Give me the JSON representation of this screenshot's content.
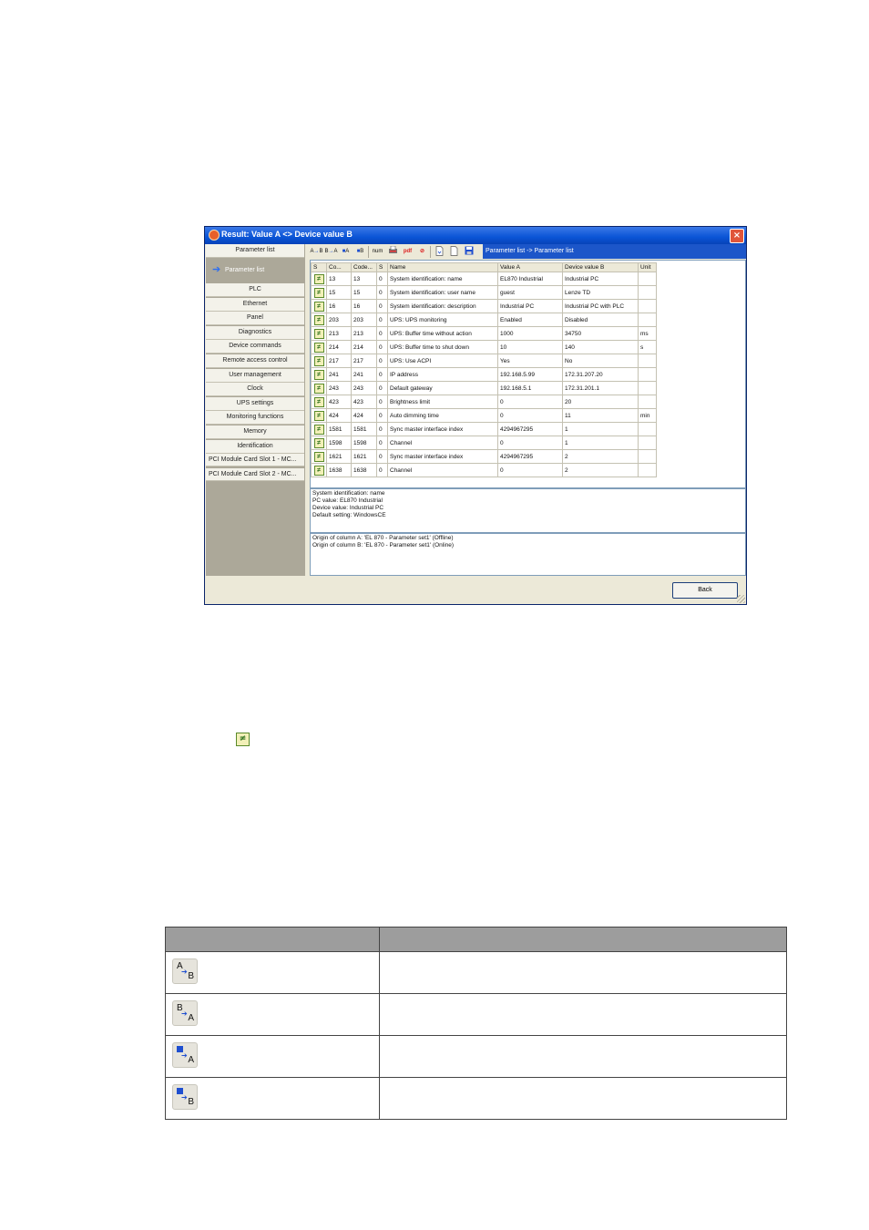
{
  "window": {
    "title": "Result: Value A <> Device value B",
    "close_label": "×",
    "breadcrumb": "Parameter list -> Parameter list",
    "back_label": "Back"
  },
  "nav": {
    "header": "Parameter list",
    "active": "Parameter list",
    "items": [
      "PLC",
      "Ethernet",
      "Panel",
      "Diagnostics",
      "Device commands",
      "Remote access control",
      "User management",
      "Clock",
      "UPS settings",
      "Monitoring functions",
      "Memory",
      "Identification",
      "PCI Module Card Slot 1 - MC...",
      "PCI Module Card Slot 2 - MC..."
    ]
  },
  "toolbar": {
    "ab": "A→B",
    "ba": "B→A",
    "copy_a": "■A",
    "copy_b": "■B",
    "num": "num",
    "print": "print-icon",
    "pdf": "pdf-icon",
    "filter": "filter-icon",
    "doc1": "doc-icon",
    "doc2": "doc-icon",
    "save": "save-icon"
  },
  "grid": {
    "columns": [
      "S",
      "Co...",
      "Code...",
      "S",
      "Name",
      "Value A",
      "Device value B",
      "Unit"
    ],
    "rows": [
      [
        "13",
        "13",
        "0",
        "System identification: name",
        "EL870 Industrial",
        "Industrial PC",
        ""
      ],
      [
        "15",
        "15",
        "0",
        "System identification: user name",
        "guest",
        "Lenze TD",
        ""
      ],
      [
        "16",
        "16",
        "0",
        "System identification: description",
        "Industrial PC",
        "Industrial PC with PLC",
        ""
      ],
      [
        "203",
        "203",
        "0",
        "UPS: UPS monitoring",
        "Enabled",
        "Disabled",
        ""
      ],
      [
        "213",
        "213",
        "0",
        "UPS: Buffer time without action",
        "1000",
        "34750",
        "ms"
      ],
      [
        "214",
        "214",
        "0",
        "UPS: Buffer time to shut down",
        "10",
        "140",
        "s"
      ],
      [
        "217",
        "217",
        "0",
        "UPS: Use ACPI",
        "Yes",
        "No",
        ""
      ],
      [
        "241",
        "241",
        "0",
        "IP address",
        "192.168.5.99",
        "172.31.207.20",
        ""
      ],
      [
        "243",
        "243",
        "0",
        "Default gateway",
        "192.168.5.1",
        "172.31.201.1",
        ""
      ],
      [
        "423",
        "423",
        "0",
        "Brightness limit",
        "0",
        "20",
        ""
      ],
      [
        "424",
        "424",
        "0",
        "Auto dimming time",
        "0",
        "11",
        "min"
      ],
      [
        "1581",
        "1581",
        "0",
        "Sync master interface index",
        "4294967295",
        "1",
        ""
      ],
      [
        "1598",
        "1598",
        "0",
        "Channel",
        "0",
        "1",
        ""
      ],
      [
        "1621",
        "1621",
        "0",
        "Sync master interface index",
        "4294967295",
        "2",
        ""
      ],
      [
        "1638",
        "1638",
        "0",
        "Channel",
        "0",
        "2",
        ""
      ]
    ]
  },
  "details": [
    "System identification: name",
    "PC value: EL870 Industrial",
    "Device value: Industrial PC",
    "Default setting: WindowsCE"
  ],
  "origin": [
    "Origin of column A: 'EL 870 - Parameter set1' (Offline)",
    "Origin of column B: 'EL 870 - Parameter set1' (Online)"
  ],
  "legend_icons": [
    {
      "top": "A",
      "bottom": "B",
      "kind": "text"
    },
    {
      "top": "B",
      "bottom": "A",
      "kind": "text"
    },
    {
      "top": "",
      "bottom": "A",
      "kind": "block"
    },
    {
      "top": "",
      "bottom": "B",
      "kind": "block"
    }
  ]
}
